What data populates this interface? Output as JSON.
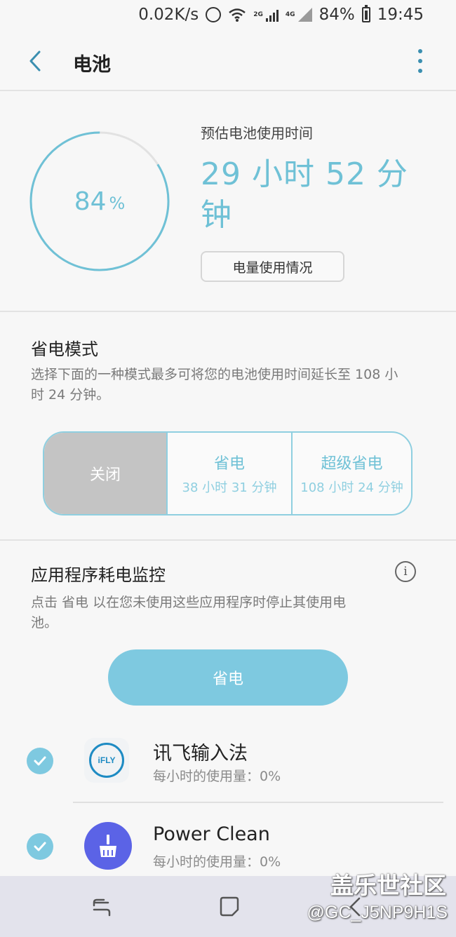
{
  "status_bar": {
    "net_speed": "0.02K/s",
    "network_2g": "2G",
    "network_4g": "4G",
    "battery_percent": "84%",
    "time": "19:45",
    "icons": [
      "alarm-icon",
      "wifi-icon",
      "signal-icon",
      "battery-icon"
    ]
  },
  "header": {
    "title": "电池",
    "back_icon": "back-arrow-icon",
    "menu_icon": "more-vertical-icon"
  },
  "battery": {
    "level_value": 84,
    "level_text": "84",
    "level_unit": "%",
    "estimate_label": "预估电池使用时间",
    "estimate_value": "29 小时 52 分钟",
    "usage_button": "电量使用情况",
    "accent_color": "#6fc1d6"
  },
  "power_saving": {
    "title": "省电模式",
    "description": "选择下面的一种模式最多可将您的电池使用时间延长至 108 小时 24 分钟。",
    "modes": [
      {
        "label": "关闭",
        "sub": "",
        "selected": true
      },
      {
        "label": "省电",
        "sub": "38 小时 31 分钟",
        "selected": false
      },
      {
        "label": "超级省电",
        "sub": "108 小时 24 分钟",
        "selected": false
      }
    ]
  },
  "app_monitor": {
    "title": "应用程序耗电监控",
    "info_icon": "i",
    "description": "点击 省电 以在您未使用这些应用程序时停止其使用电池。",
    "save_button": "省电",
    "apps": [
      {
        "name": "讯飞输入法",
        "usage": "每小时的使用量：0%",
        "icon_text": "iFLY",
        "checked": true
      },
      {
        "name": "Power Clean",
        "usage": "每小时的使用量：0%",
        "icon": "broom-icon",
        "checked": true
      }
    ]
  },
  "watermark": {
    "line1": "盖乐世社区",
    "line2": "@GC_J5NP9H1S"
  }
}
